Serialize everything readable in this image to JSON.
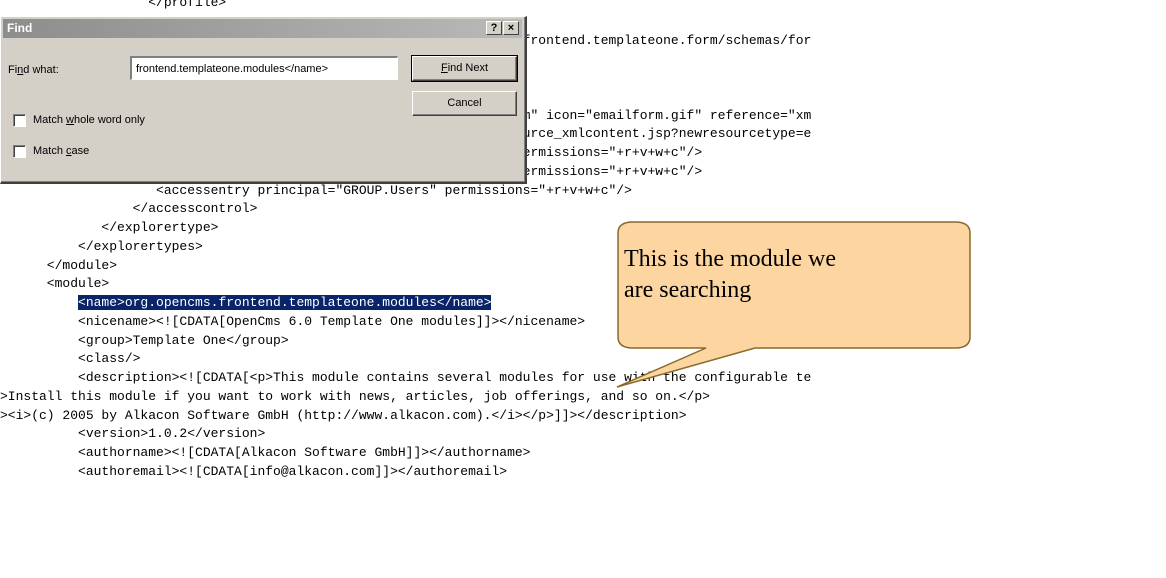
{
  "editor": {
    "lines": [
      {
        "before": "                   </profile>",
        "highlight": "",
        "after": ""
      },
      {
        "before": "",
        "highlight": "",
        "after": ""
      },
      {
        "before": "                                               modules/org.opencms.frontend.templateone.form/schemas/for",
        "highlight": "",
        "after": ""
      },
      {
        "before": "",
        "highlight": "",
        "after": ""
      },
      {
        "before": "",
        "highlight": "",
        "after": ""
      },
      {
        "before": "",
        "highlight": "",
        "after": ""
      },
      {
        "before": "                                               y=\"fileicon.emailform\" icon=\"emailform.gif\" reference=\"xm",
        "highlight": "",
        "after": ""
      },
      {
        "before": "                                               ontent\" uri=\"newresource_xmlcontent.jsp?newresourcetype=e",
        "highlight": "",
        "after": ""
      },
      {
        "before": "                    <accessentry principal=\"GROUP.Administrators\" permissions=\"+r+v+w+c\"/>",
        "highlight": "",
        "after": ""
      },
      {
        "before": "                    <accessentry principal=\"GROUP.Projectmanager\" permissions=\"+r+v+w+c\"/>",
        "highlight": "",
        "after": ""
      },
      {
        "before": "                    <accessentry principal=\"GROUP.Users\" permissions=\"+r+v+w+c\"/>",
        "highlight": "",
        "after": ""
      },
      {
        "before": "                 </accesscontrol>",
        "highlight": "",
        "after": ""
      },
      {
        "before": "             </explorertype>",
        "highlight": "",
        "after": ""
      },
      {
        "before": "          </explorertypes>",
        "highlight": "",
        "after": ""
      },
      {
        "before": "      </module>",
        "highlight": "",
        "after": ""
      },
      {
        "before": "      <module>",
        "highlight": "",
        "after": ""
      },
      {
        "before": "          ",
        "highlight": "<name>org.opencms.frontend.templateone.modules</name>",
        "after": ""
      },
      {
        "before": "          <nicename><![CDATA[OpenCms 6.0 Template One modules]]></nicename>",
        "highlight": "",
        "after": ""
      },
      {
        "before": "          <group>Template One</group>",
        "highlight": "",
        "after": ""
      },
      {
        "before": "          <class/>",
        "highlight": "",
        "after": ""
      },
      {
        "before": "          <description><![CDATA[<p>This module contains several modules for use with the configurable te",
        "highlight": "",
        "after": ""
      },
      {
        "before": ">Install this module if you want to work with news, articles, job offerings, and so on.</p>",
        "highlight": "",
        "after": ""
      },
      {
        "before": "><i>(c) 2005 by Alkacon Software GmbH (http://www.alkacon.com).</i></p>]]></description>",
        "highlight": "",
        "after": ""
      },
      {
        "before": "          <version>1.0.2</version>",
        "highlight": "",
        "after": ""
      },
      {
        "before": "          <authorname><![CDATA[Alkacon Software GmbH]]></authorname>",
        "highlight": "",
        "after": ""
      },
      {
        "before": "          <authoremail><![CDATA[info@alkacon.com]]></authoremail>",
        "highlight": "",
        "after": ""
      }
    ]
  },
  "dialog": {
    "title": "Find",
    "help_label": "?",
    "close_label": "×",
    "find_what_label_pre": "Fi",
    "find_what_label_key": "n",
    "find_what_label_post": "d what:",
    "find_input_value": "frontend.templateone.modules</name>",
    "find_next_key": "F",
    "find_next_rest": "ind Next",
    "cancel_label": "Cancel",
    "match_whole_pre": "Match ",
    "match_whole_key": "w",
    "match_whole_post": "hole word only",
    "match_case_pre": "Match ",
    "match_case_key": "c",
    "match_case_post": "ase",
    "match_whole_checked": false,
    "match_case_checked": false
  },
  "callout": {
    "line1": "This is the module we",
    "line2": "are searching",
    "fill_color": "#fcd5a0",
    "stroke_color": "#8a6a2c"
  },
  "colors": {
    "highlight_bg": "#0a246a",
    "highlight_fg": "#ffffff",
    "dialog_face": "#d4d0c8"
  }
}
